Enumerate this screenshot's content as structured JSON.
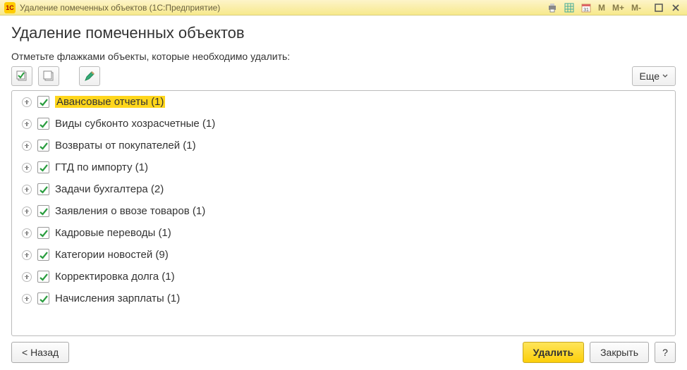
{
  "window": {
    "title": "Удаление помеченных объектов  (1С:Предприятие)",
    "logo_text": "1C"
  },
  "titlebar_tools": {
    "m": "M",
    "mplus": "M+",
    "mminus": "M-"
  },
  "page": {
    "title": "Удаление помеченных объектов",
    "instruction": "Отметьте флажками объекты, которые необходимо удалить:"
  },
  "toolbar": {
    "more_label": "Еще"
  },
  "tree": {
    "items": [
      {
        "label": "Авансовые отчеты (1)",
        "checked": true,
        "highlighted": true
      },
      {
        "label": "Виды субконто хозрасчетные (1)",
        "checked": true,
        "highlighted": false
      },
      {
        "label": "Возвраты от покупателей (1)",
        "checked": true,
        "highlighted": false
      },
      {
        "label": "ГТД по импорту (1)",
        "checked": true,
        "highlighted": false
      },
      {
        "label": "Задачи бухгалтера (2)",
        "checked": true,
        "highlighted": false
      },
      {
        "label": "Заявления о ввозе товаров (1)",
        "checked": true,
        "highlighted": false
      },
      {
        "label": "Кадровые переводы (1)",
        "checked": true,
        "highlighted": false
      },
      {
        "label": "Категории новостей (9)",
        "checked": true,
        "highlighted": false
      },
      {
        "label": "Корректировка долга (1)",
        "checked": true,
        "highlighted": false
      },
      {
        "label": "Начисления зарплаты (1)",
        "checked": true,
        "highlighted": false
      }
    ]
  },
  "footer": {
    "back_label": "< Назад",
    "delete_label": "Удалить",
    "close_label": "Закрыть",
    "help_label": "?"
  }
}
